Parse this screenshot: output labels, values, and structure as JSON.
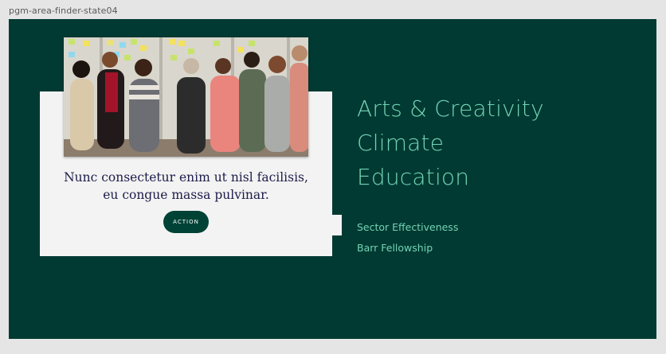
{
  "frame": {
    "label": "pgm-area-finder-state04"
  },
  "card": {
    "photo_alt": "group photo",
    "quote": "Nunc consectetur enim ut nisl facilisis, eu congue massa pulvinar.",
    "action_label": "ACTION"
  },
  "areas": [
    {
      "label": "Arts & Creativity"
    },
    {
      "label": "Climate"
    },
    {
      "label": "Education"
    }
  ],
  "links": [
    {
      "label": "Sector Effectiveness"
    },
    {
      "label": "Barr Fellowship"
    }
  ],
  "colors": {
    "canvas": "#003a32",
    "accent": "#73d3b4",
    "card": "#f3f3f3",
    "button": "#004236",
    "quote_text": "#1c1c4a"
  }
}
